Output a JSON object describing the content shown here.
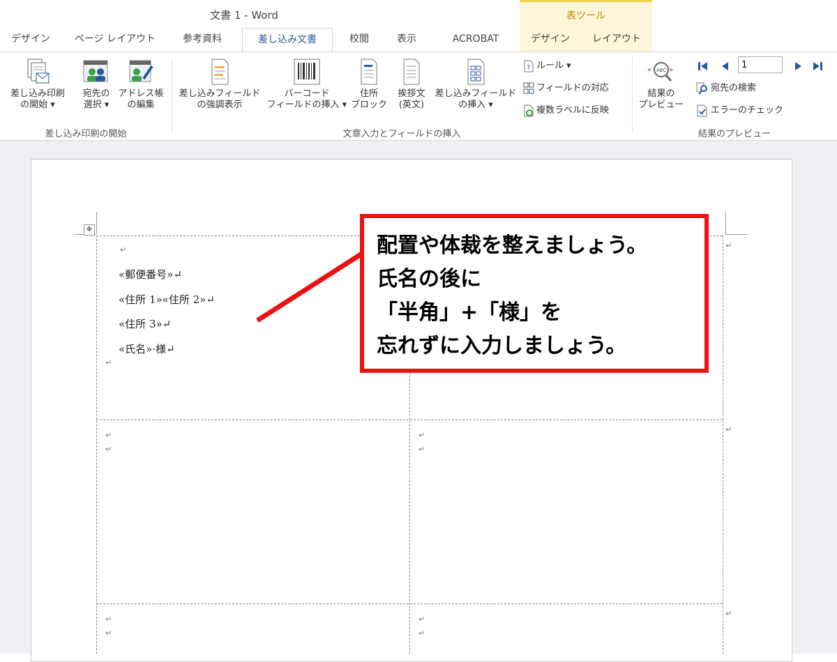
{
  "window": {
    "title": "文書 1 - Word",
    "contextual_title": "表ツール"
  },
  "tabs": [
    "デザイン",
    "ページ レイアウト",
    "参考資料",
    "差し込み文書",
    "校閲",
    "表示",
    "ACROBAT",
    "デザイン",
    "レイアウト"
  ],
  "ribbon": {
    "start": {
      "start_line1": "差し込み印刷",
      "start_line2": "の開始 ▾",
      "recipients_line1": "宛先の",
      "recipients_line2": "選択 ▾",
      "address_line1": "アドレス帳",
      "address_line2": "の編集",
      "group_label": "差し込み印刷の開始"
    },
    "write": {
      "highlight_line1": "差し込みフィールド",
      "highlight_line2": "の強調表示",
      "barcode_line1": "バーコード",
      "barcode_line2": "フィールドの挿入 ▾",
      "address_block_line1": "住所",
      "address_block_line2": "ブロック",
      "greeting_line1": "挨拶文",
      "greeting_line2": "(英文)",
      "insert_field_line1": "差し込みフィールド",
      "insert_field_line2": "の挿入 ▾",
      "rules": "ルール ▾",
      "match_fields": "フィールドの対応",
      "update_labels": "複数ラベルに反映",
      "group_label": "文章入力とフィールドの挿入"
    },
    "preview": {
      "preview_line1": "結果の",
      "preview_line2": "プレビュー",
      "record_value": "1",
      "find_recipient": "宛先の検索",
      "check_errors": "エラーのチェック",
      "group_label": "結果のプレビュー"
    }
  },
  "document": {
    "para_mark": "↵",
    "fields": [
      "«郵便番号»↵",
      "«住所 1»«住所 2»↵",
      "«住所 3»↵",
      "«氏名»·様↵"
    ],
    "move_handle": "✥"
  },
  "callout": {
    "lines": [
      "配置や体裁を整えましょう。",
      "氏名の後に",
      "「半角」+「様」を",
      "忘れずに入力しましょう。"
    ],
    "border_color": "#ee1111"
  }
}
